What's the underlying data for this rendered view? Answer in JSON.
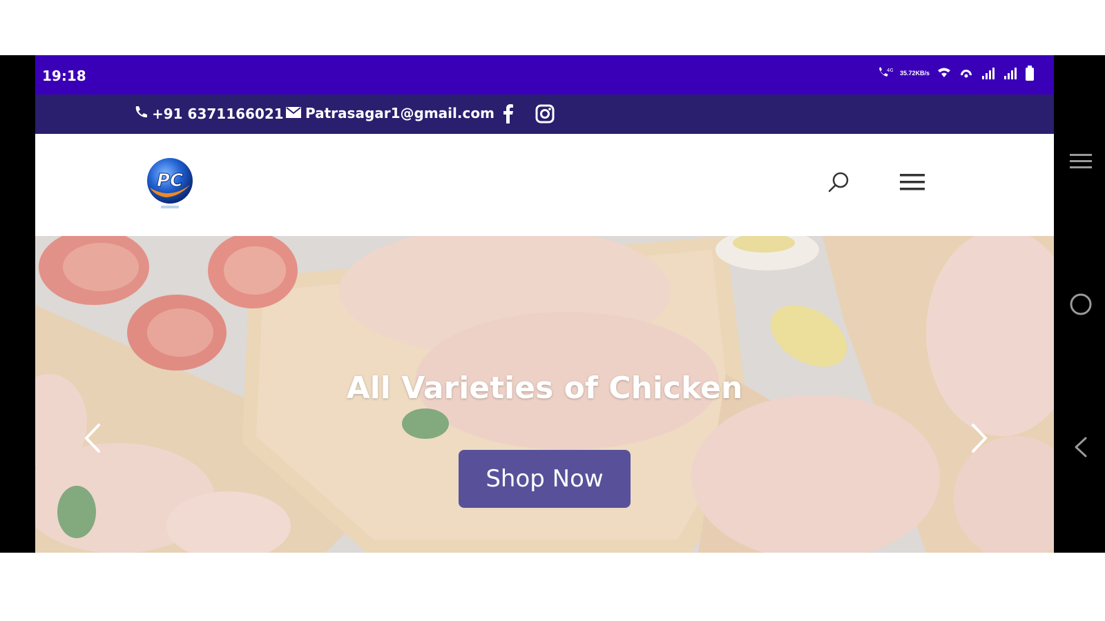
{
  "status_bar": {
    "time": "19:18",
    "speed_top": "35.72",
    "speed_bottom": "KB/s",
    "icons": [
      "volte-call-icon",
      "network-speed",
      "wifi-calling-icon",
      "hotspot-icon",
      "signal-icon",
      "signal-icon-2",
      "battery-icon"
    ],
    "bg_color": "#3a00b8"
  },
  "top_bar": {
    "phone": "+91 6371166021",
    "email": "Patrasagar1@gmail.com",
    "social": [
      "facebook-icon",
      "instagram-icon"
    ],
    "bg_color": "#2a1e6e"
  },
  "header": {
    "logo_text": "PC",
    "icons": [
      "search-icon",
      "hamburger-menu-icon"
    ]
  },
  "hero": {
    "title": "All Varieties of Chicken",
    "button_label": "Shop Now",
    "button_color": "#58519a",
    "prev_icon": "chevron-left-icon",
    "next_icon": "chevron-right-icon"
  },
  "system_nav": [
    "recent-apps-icon",
    "home-icon",
    "back-icon"
  ]
}
